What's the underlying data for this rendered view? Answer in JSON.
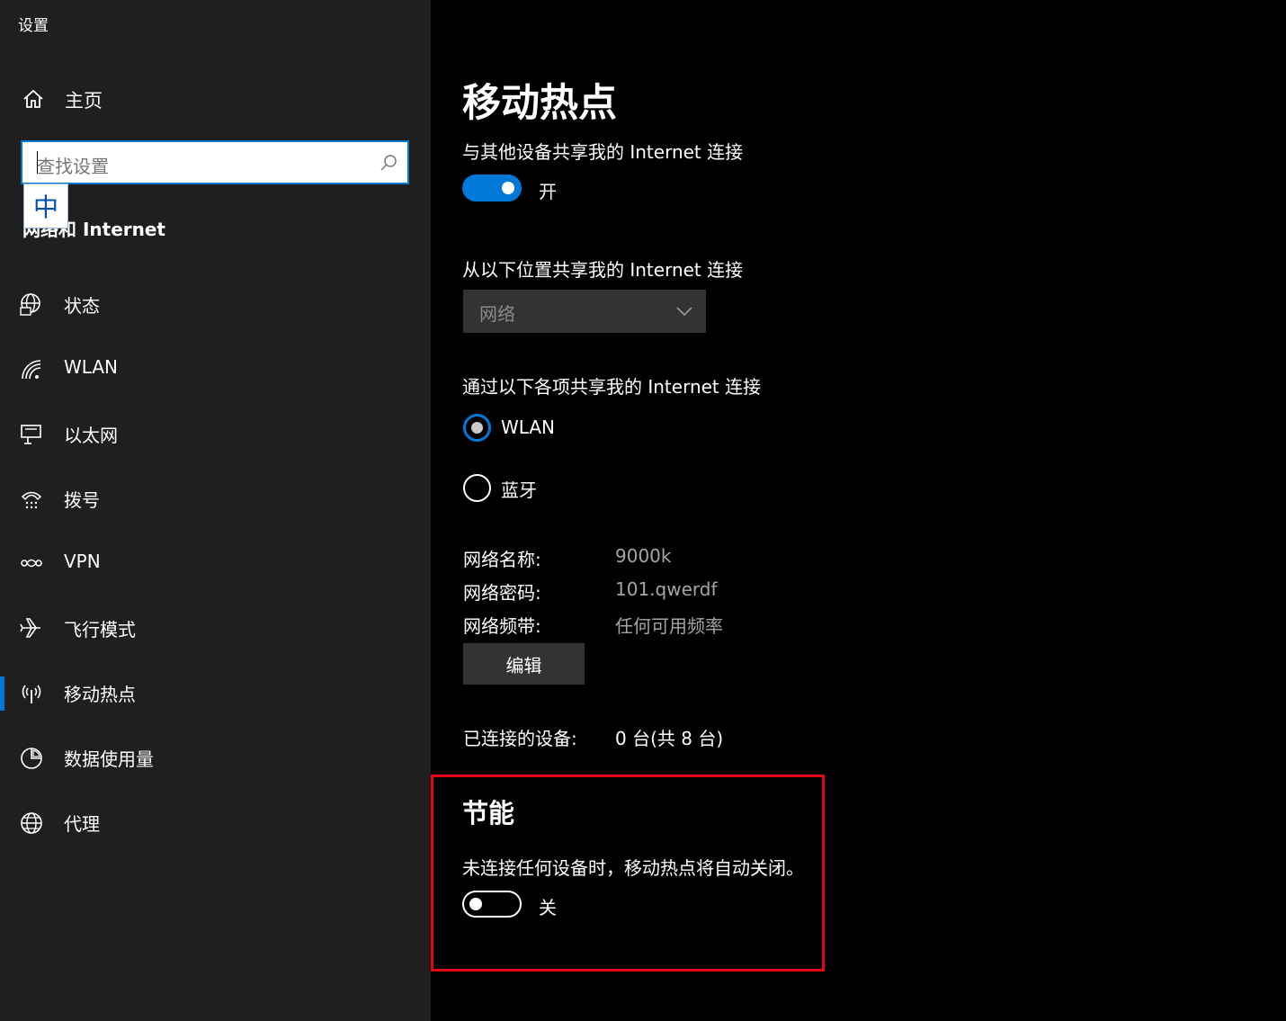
{
  "app": {
    "title": "设置"
  },
  "sidebar": {
    "home_label": "主页",
    "search_placeholder": "查找设置",
    "ime_char": "中",
    "section_title": "网络和 Internet",
    "items": [
      {
        "label": "状态",
        "icon": "globe-monitor-icon"
      },
      {
        "label": "WLAN",
        "icon": "wifi-icon"
      },
      {
        "label": "以太网",
        "icon": "ethernet-icon"
      },
      {
        "label": "拨号",
        "icon": "dialup-icon"
      },
      {
        "label": "VPN",
        "icon": "vpn-icon"
      },
      {
        "label": "飞行模式",
        "icon": "airplane-icon"
      },
      {
        "label": "移动热点",
        "icon": "hotspot-icon",
        "active": true
      },
      {
        "label": "数据使用量",
        "icon": "data-usage-icon"
      },
      {
        "label": "代理",
        "icon": "proxy-globe-icon"
      }
    ]
  },
  "main": {
    "title": "移动热点",
    "share_label": "与其他设备共享我的 Internet 连接",
    "share_toggle": {
      "state": "开"
    },
    "source_label": "从以下位置共享我的 Internet 连接",
    "source_value": "网络",
    "via_label": "通过以下各项共享我的 Internet 连接",
    "via_options": [
      {
        "label": "WLAN",
        "checked": true
      },
      {
        "label": "蓝牙",
        "checked": false
      }
    ],
    "network": {
      "name_key": "网络名称:",
      "name_val": "9000k",
      "pass_key": "网络密码:",
      "pass_val": "101.qwerdf",
      "band_key": "网络频带:",
      "band_val": "任何可用频率"
    },
    "edit_label": "编辑",
    "connected_key": "已连接的设备:",
    "connected_val": "0 台(共 8 台)",
    "power": {
      "heading": "节能",
      "description": "未连接任何设备时，移动热点将自动关闭。",
      "toggle_state": "关"
    }
  },
  "colors": {
    "accent": "#0078d7",
    "highlight_box": "#e30613",
    "sidebar_bg": "#1f1f1f",
    "main_bg": "#000000"
  }
}
